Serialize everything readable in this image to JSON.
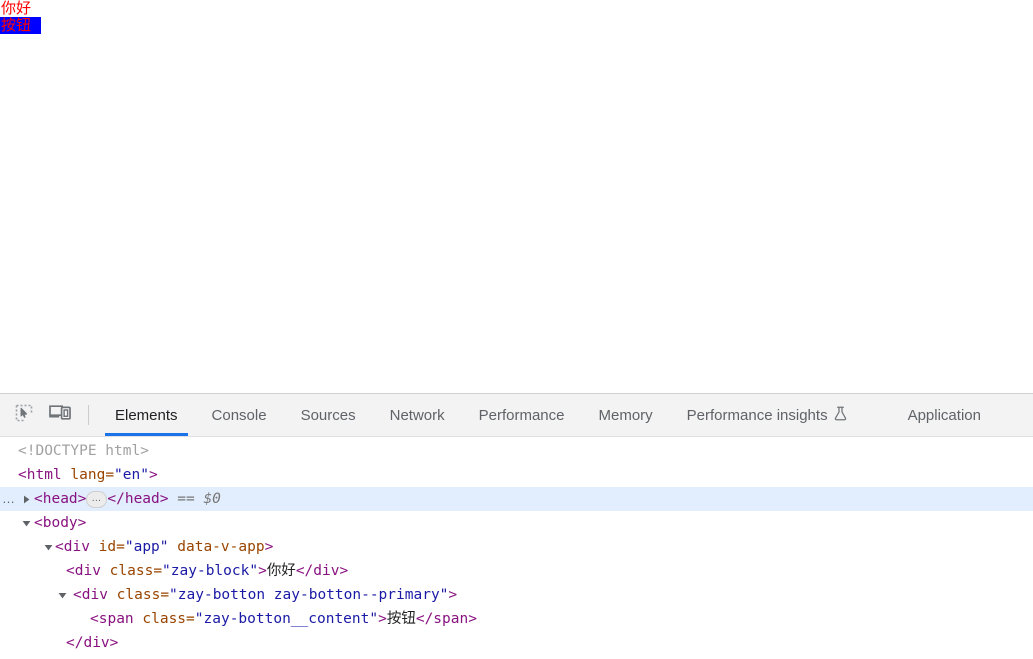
{
  "viewport": {
    "block_text": "你好",
    "button_text": "按钮",
    "text_color": "#ff0000",
    "button_bg": "#0000ff"
  },
  "devtools": {
    "toolbar": {
      "inspect_icon": "inspect-element-icon",
      "device_icon": "device-toolbar-icon"
    },
    "tabs": [
      {
        "label": "Elements",
        "selected": true,
        "icon": null
      },
      {
        "label": "Console",
        "selected": false,
        "icon": null
      },
      {
        "label": "Sources",
        "selected": false,
        "icon": null
      },
      {
        "label": "Network",
        "selected": false,
        "icon": null
      },
      {
        "label": "Performance",
        "selected": false,
        "icon": null
      },
      {
        "label": "Memory",
        "selected": false,
        "icon": null
      },
      {
        "label": "Performance insights",
        "selected": false,
        "icon": "flask-icon"
      },
      {
        "label": "Application",
        "selected": false,
        "icon": null
      }
    ],
    "accent_color": "#1a73e8",
    "selected_row_bg": "#e2edfd",
    "dom": {
      "line_doctype": "<!DOCTYPE html>",
      "line_html": {
        "open": "<html ",
        "attr_name": "lang",
        "attr_eq": "=",
        "attr_value": "\"en\"",
        "close": ">"
      },
      "line_head": {
        "open": "<head>",
        "ellipsis": "…",
        "close": "</head>",
        "eqeq": "==",
        "dollar": "$0",
        "gutter": "…"
      },
      "line_body": "<body>",
      "line_app": {
        "open": "<div ",
        "attr1_name": "id",
        "attr1_eq": "=",
        "attr1_value": "\"app\"",
        "attr2_name": "data-v-app",
        "close": ">"
      },
      "line_block": {
        "open": "<div ",
        "attr_name": "class",
        "attr_eq": "=",
        "attr_value": "\"zay-block\"",
        "gt": ">",
        "text": "你好",
        "close": "</div>"
      },
      "line_botton": {
        "open": "<div ",
        "attr_name": "class",
        "attr_eq": "=",
        "attr_value": "\"zay-botton zay-botton--primary\"",
        "close": ">"
      },
      "line_span": {
        "open": "<span ",
        "attr_name": "class",
        "attr_eq": "=",
        "attr_value": "\"zay-botton__content\"",
        "gt": ">",
        "text": "按钮",
        "close": "</span>"
      },
      "line_close_div": "</div>"
    }
  }
}
